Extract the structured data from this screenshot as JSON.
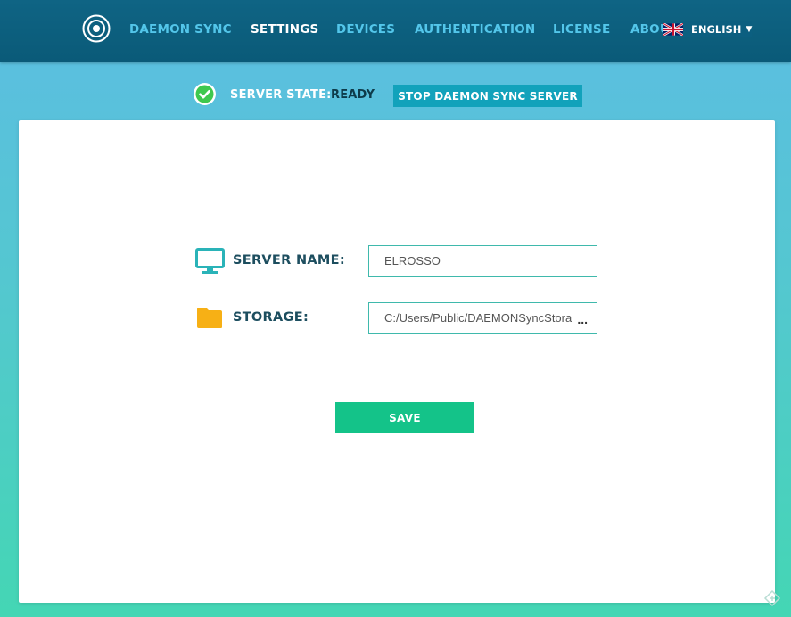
{
  "topbar": {
    "logo_icon": "target-ring-icon",
    "nav": [
      {
        "label": "DAEMON SYNC",
        "active": false
      },
      {
        "label": "SETTINGS",
        "active": true
      },
      {
        "label": "DEVICES",
        "active": false
      },
      {
        "label": "AUTHENTICATION",
        "active": false
      },
      {
        "label": "LICENSE",
        "active": false
      },
      {
        "label": "ABOUT",
        "active": false
      }
    ],
    "language": {
      "label": "ENGLISH",
      "flag_icon": "uk-flag-icon",
      "caret_icon": "caret-down-icon"
    }
  },
  "status": {
    "icon": "check-circle-icon",
    "label": "SERVER STATE:",
    "value": "READY",
    "stop_button": "STOP DAEMON SYNC SERVER"
  },
  "form": {
    "server_name": {
      "label": "SERVER NAME:",
      "icon": "monitor-icon",
      "value": "ELROSSO"
    },
    "storage": {
      "label": "STORAGE:",
      "icon": "folder-icon",
      "value": "C:/Users/Public/DAEMONSyncStorage",
      "browse_label": "..."
    },
    "save_button": "SAVE"
  },
  "colors": {
    "topbar": "#0c5f80",
    "nav_inactive": "#53c6ea",
    "nav_active": "#ffffff",
    "stop_button": "#12a2bb",
    "save_button": "#14c389",
    "status_ok": "#3fc84e",
    "field_border": "#3fb9ac",
    "monitor_icon": "#2ab3b8",
    "folder_icon": "#f7b015"
  }
}
